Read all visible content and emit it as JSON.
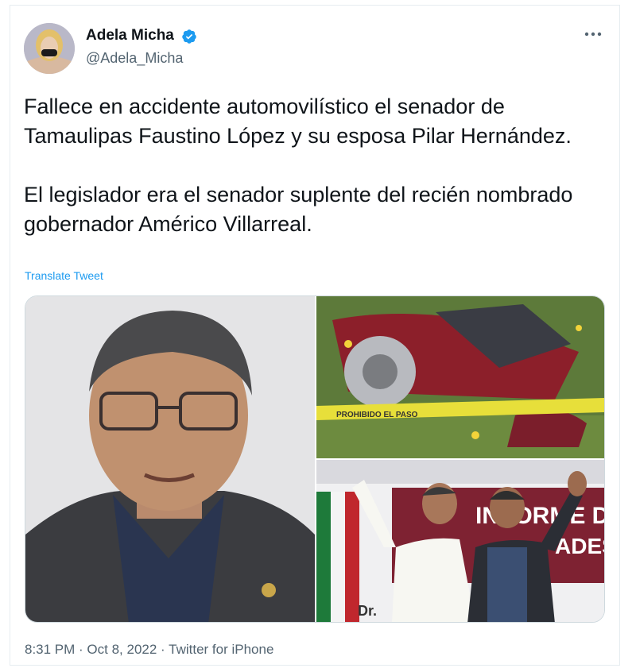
{
  "tweet": {
    "author_name": "Adela Micha",
    "author_handle": "@Adela_Micha",
    "paragraphs": [
      "Fallece en accidente automovilístico el senador de Tamaulipas Faustino López y su esposa Pilar Hernández.",
      "El legislador era el senador suplente del recién nombrado gobernador Américo Villarreal."
    ],
    "translate_label": "Translate Tweet",
    "time": "8:31 PM",
    "date": "Oct 8, 2022",
    "source": "Twitter for iPhone",
    "separator": " · "
  },
  "media": {
    "crash_tape_text": "PROHIBIDO EL PASO",
    "banner_text": "INFORME DE",
    "banner_text_2": "ADES",
    "banner_name": "Dr."
  },
  "colors": {
    "accent": "#1d9bf0",
    "text": "#0f1419",
    "muted": "#536471"
  },
  "icons": [
    "verified-badge-icon",
    "more-options-icon"
  ]
}
